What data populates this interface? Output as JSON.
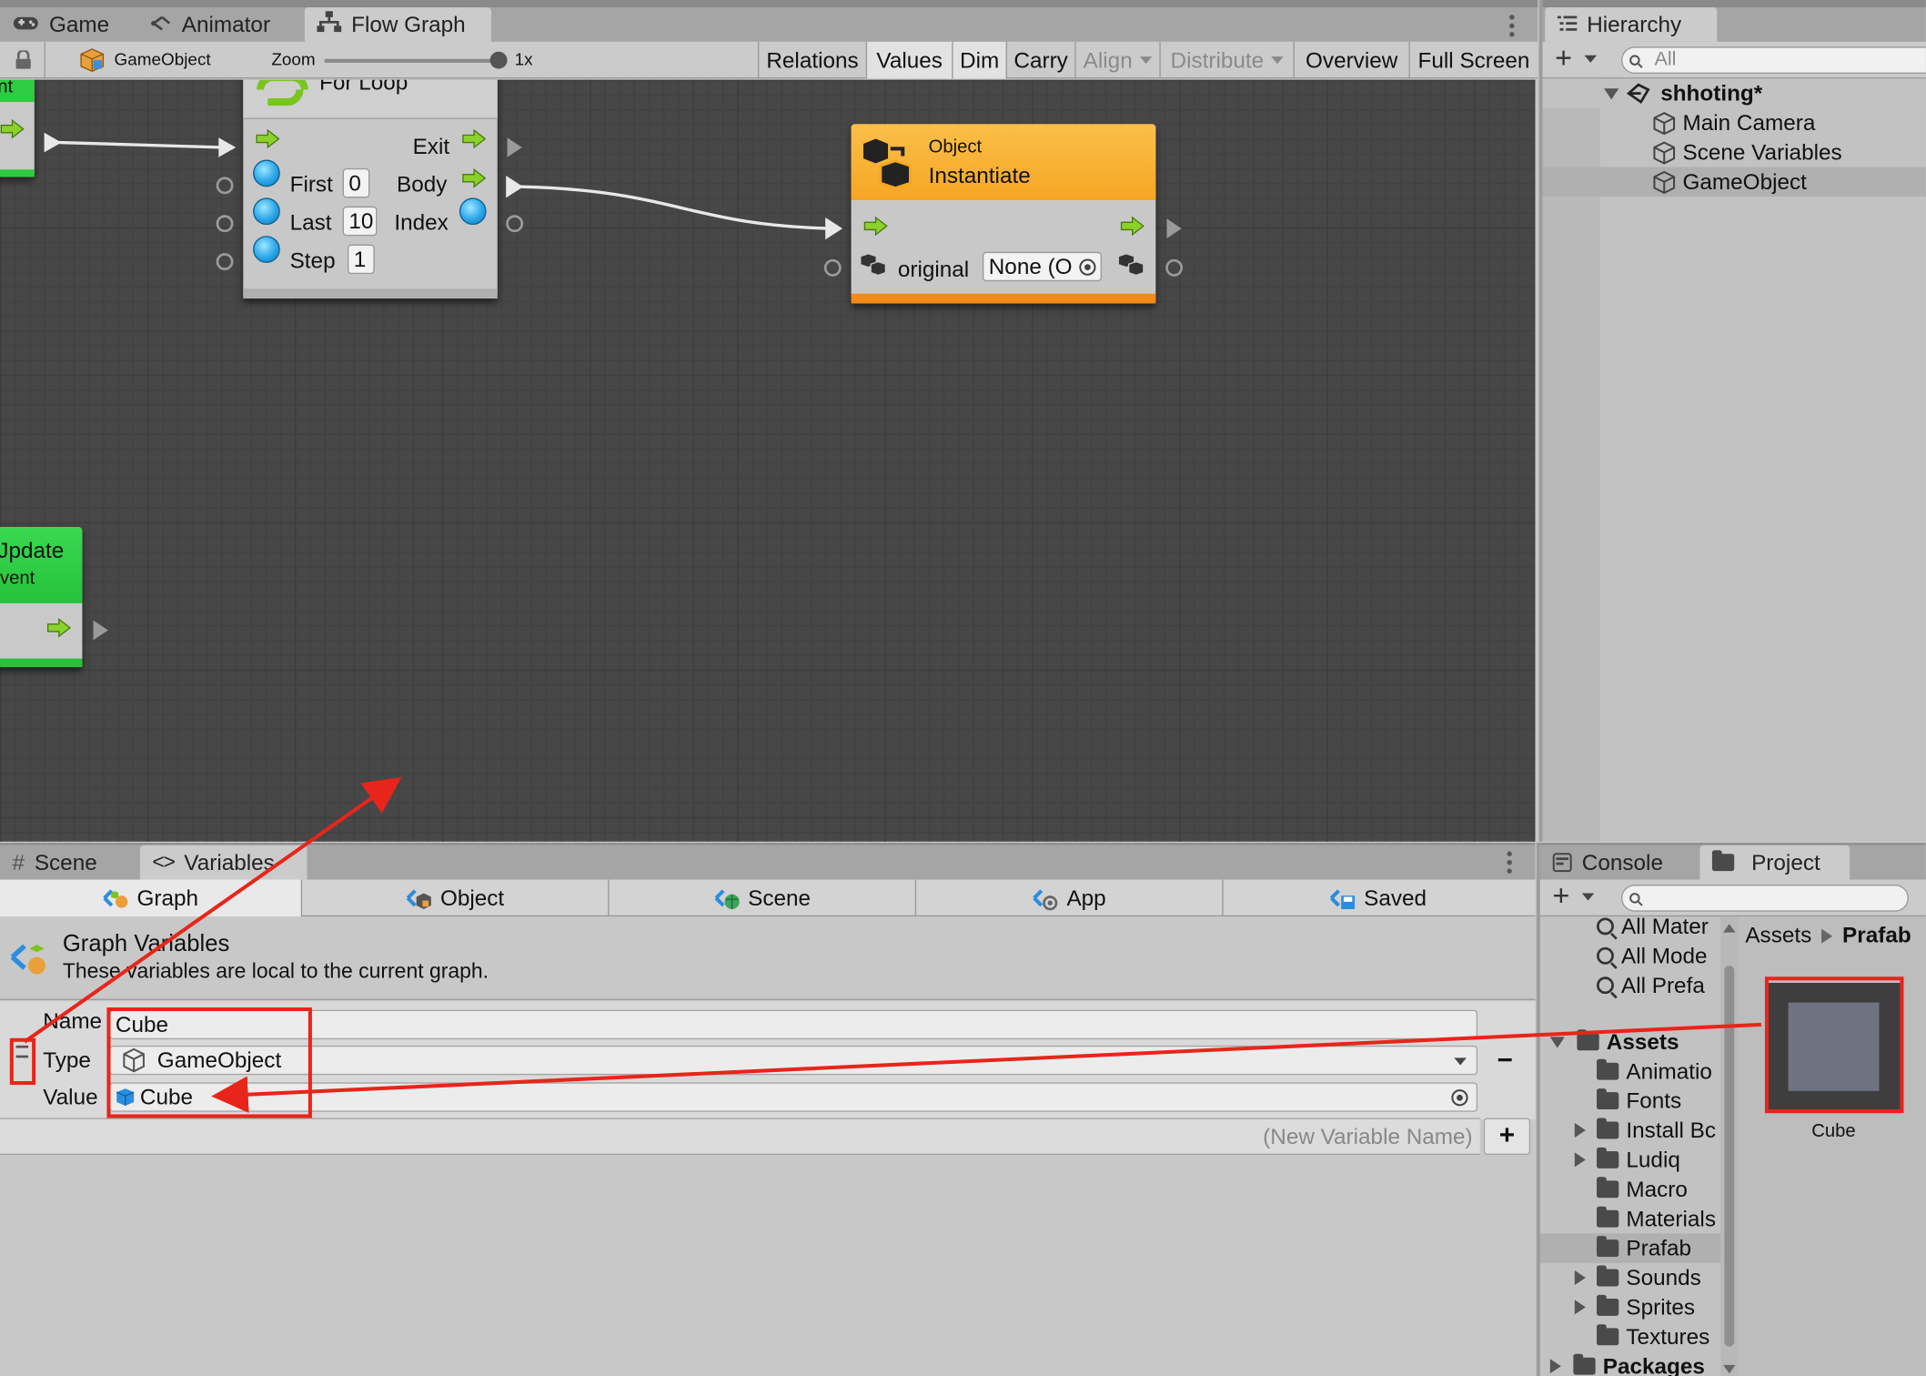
{
  "top_tabs": [
    {
      "label": "Game",
      "icon": "gamepad-icon"
    },
    {
      "label": "Animator",
      "icon": "animator-icon"
    },
    {
      "label": "Flow Graph",
      "icon": "flow-graph-icon"
    }
  ],
  "toolbar": {
    "object_label": "GameObject",
    "zoom_label": "Zoom",
    "zoom_value": "1x",
    "zoom_level": 1.0,
    "buttons": [
      "Relations",
      "Values",
      "Dim",
      "Carry",
      "Align",
      "Distribute",
      "Overview",
      "Full Screen"
    ]
  },
  "graph": {
    "event_node_partial": "nt",
    "for_loop": {
      "title": "For Loop",
      "exit": "Exit",
      "first": "First",
      "first_value": "0",
      "body": "Body",
      "last": "Last",
      "last_value": "10",
      "index": "Index",
      "step": "Step",
      "step_value": "1"
    },
    "instantiate": {
      "category": "Object",
      "title": "Instantiate",
      "input_label": "original",
      "input_value": "None (O",
      "header_color": "#f5a623"
    },
    "update_node": {
      "line1": "Jpdate",
      "line2": "vent"
    },
    "event_color": "#2ecc40"
  },
  "hierarchy": {
    "tab": "Hierarchy",
    "search_placeholder": "All",
    "scene": "shhoting*",
    "items": [
      "Main Camera",
      "Scene Variables",
      "GameObject"
    ]
  },
  "variables_panel": {
    "tabs": [
      {
        "label": "Scene",
        "icon": "hash-icon"
      },
      {
        "label": "Variables",
        "icon": "code-icon"
      }
    ],
    "scopes": [
      "Graph",
      "Object",
      "Scene",
      "App",
      "Saved"
    ],
    "header_title": "Graph Variables",
    "header_desc": "These variables are local to the current graph.",
    "name_label": "Name",
    "name_value": "Cube",
    "type_label": "Type",
    "type_value": "GameObject",
    "value_label": "Value",
    "value_value": "Cube",
    "new_var_placeholder": "(New Variable Name)",
    "add_symbol": "+",
    "remove_symbol": "−"
  },
  "project": {
    "tabs": [
      "Console",
      "Project"
    ],
    "favorites": [
      "All Mater",
      "All Mode",
      "All Prefa"
    ],
    "assets_root": "Assets",
    "folders": [
      {
        "name": "Animatio",
        "expandable": false
      },
      {
        "name": "Fonts",
        "expandable": false
      },
      {
        "name": "Install Bc",
        "expandable": true
      },
      {
        "name": "Ludiq",
        "expandable": true
      },
      {
        "name": "Macro",
        "expandable": false
      },
      {
        "name": "Materials",
        "expandable": false
      },
      {
        "name": "Prafab",
        "expandable": false
      },
      {
        "name": "Sounds",
        "expandable": true
      },
      {
        "name": "Sprites",
        "expandable": true
      },
      {
        "name": "Textures",
        "expandable": false
      }
    ],
    "packages": "Packages",
    "breadcrumb": [
      "Assets",
      "Prafab"
    ],
    "asset_name": "Cube"
  },
  "annotation_color": "#e8251a"
}
